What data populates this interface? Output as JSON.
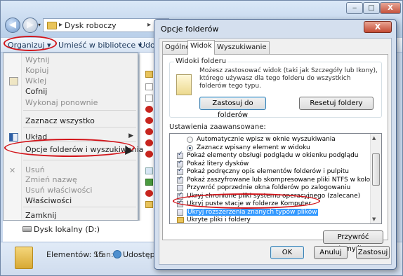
{
  "explorer": {
    "address": {
      "path": "Dysk roboczy"
    },
    "window_controls": {
      "minimize": "‒",
      "maximize": "□",
      "close": "X"
    },
    "toolbar": {
      "organize": "Organizuj ▾",
      "library": "Umieść w bibliotece ▾",
      "share": "Udo"
    },
    "menu": {
      "items": [
        {
          "label": "Wytnij",
          "disabled": true
        },
        {
          "label": "Kopiuj",
          "disabled": true
        },
        {
          "label": "Wklej",
          "disabled": true
        },
        {
          "label": "Cofnij",
          "disabled": false
        },
        {
          "label": "Wykonaj ponownie",
          "disabled": true
        },
        {
          "label": "Zaznacz wszystko",
          "disabled": false
        },
        {
          "label": "Układ",
          "disabled": false
        },
        {
          "label": "Opcje folderów i wyszukiwania",
          "disabled": false
        },
        {
          "label": "Usuń",
          "disabled": true
        },
        {
          "label": "Zmień nazwę",
          "disabled": true
        },
        {
          "label": "Usuń właściwości",
          "disabled": true
        },
        {
          "label": "Właściwości",
          "disabled": false
        },
        {
          "label": "Zamknij",
          "disabled": false
        }
      ]
    },
    "drive": {
      "label": "Dysk lokalny (D:)"
    },
    "status": {
      "count": "Elementów: 15",
      "state_label": "Stan:",
      "state_value": "Udostępnio"
    }
  },
  "dialog": {
    "title": "Opcje folderów",
    "close": "X",
    "tabs": {
      "general": "Ogólne",
      "view": "Widok",
      "search": "Wyszukiwanie"
    },
    "folder_views": {
      "title": "Widoki folderu",
      "description": "Możesz zastosować widok (taki jak Szczegóły lub Ikony), którego używasz dla tego folderu do wszystkich folderów tego typu.",
      "apply_button": "Zastosuj do folderów",
      "reset_button": "Resetuj foldery"
    },
    "advanced": {
      "label": "Ustawienia zaawansowane:",
      "rows": [
        {
          "text": "Automatycznie wpisz w oknie wyszukiwania",
          "kind": "radio",
          "checked": false,
          "indent": 1
        },
        {
          "text": "Zaznacz wpisany element w widoku",
          "kind": "radio",
          "checked": true,
          "indent": 1
        },
        {
          "text": "Pokaż elementy obsługi podglądu w okienku podglądu",
          "kind": "check",
          "checked": true,
          "indent": 0
        },
        {
          "text": "Pokaż litery dysków",
          "kind": "check",
          "checked": true,
          "indent": 0
        },
        {
          "text": "Pokaż podręczny opis elementów folderów i pulpitu",
          "kind": "check",
          "checked": true,
          "indent": 0
        },
        {
          "text": "Pokaż zaszyfrowane lub skompresowane pliki NTFS w kolorze",
          "kind": "check",
          "checked": true,
          "indent": 0
        },
        {
          "text": "Przywróć poprzednie okna folderów po zalogowaniu",
          "kind": "check",
          "checked": false,
          "indent": 0
        },
        {
          "text": "Ukryj chronione pliki systemu operacyjnego (zalecane)",
          "kind": "check",
          "checked": true,
          "indent": 0
        },
        {
          "text": "Ukryj puste stacje w folderze Komputer",
          "kind": "check",
          "checked": true,
          "indent": 0
        },
        {
          "text": "Ukryj rozszerzenia znanych typów plików",
          "kind": "check",
          "checked": false,
          "indent": 0,
          "highlight": true
        },
        {
          "text": "Ukryte pliki i foldery",
          "kind": "folder",
          "checked": false,
          "indent": 0
        }
      ],
      "restore_button": "Przywróć domyślne"
    },
    "footer": {
      "ok": "OK",
      "cancel": "Anuluj",
      "apply": "Zastosuj"
    }
  }
}
